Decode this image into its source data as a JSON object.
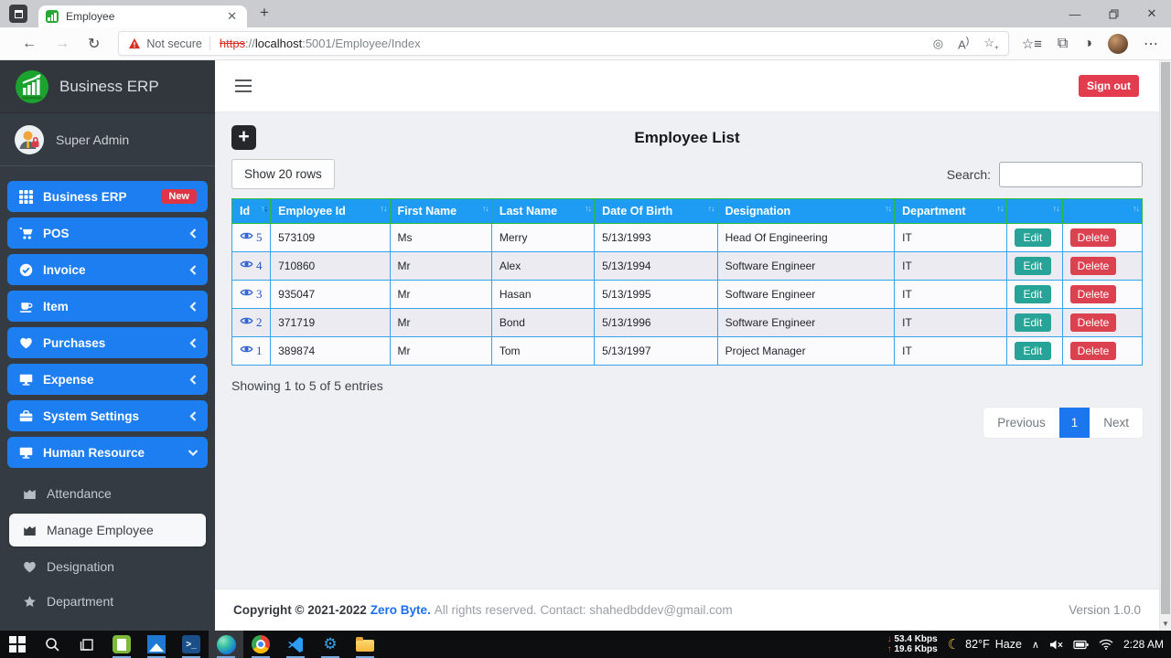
{
  "browser": {
    "tab_title": "Employee",
    "address": {
      "warning": "Not secure",
      "scheme": "https",
      "sep": "://",
      "host": "localhost",
      "path": ":5001/Employee/Index"
    }
  },
  "sidebar": {
    "brand": "Business ERP",
    "user": "Super Admin",
    "menu": [
      {
        "slug": "business-erp",
        "label": "Business ERP",
        "icon": "grid-icon",
        "badge": "New",
        "chevron": "none"
      },
      {
        "slug": "pos",
        "label": "POS",
        "icon": "cart-icon",
        "chevron": "left"
      },
      {
        "slug": "invoice",
        "label": "Invoice",
        "icon": "check-circle-icon",
        "chevron": "left"
      },
      {
        "slug": "item",
        "label": "Item",
        "icon": "mug-icon",
        "chevron": "left"
      },
      {
        "slug": "purchases",
        "label": "Purchases",
        "icon": "heart-icon",
        "chevron": "left"
      },
      {
        "slug": "expense",
        "label": "Expense",
        "icon": "desktop-icon",
        "chevron": "left"
      },
      {
        "slug": "system-settings",
        "label": "System Settings",
        "icon": "toolbox-icon",
        "chevron": "left"
      },
      {
        "slug": "human-resource",
        "label": "Human Resource",
        "icon": "desktop-icon",
        "chevron": "down"
      }
    ],
    "submenu": [
      {
        "slug": "attendance",
        "label": "Attendance",
        "icon": "chart-area-icon",
        "selected": false
      },
      {
        "slug": "manage-employee",
        "label": "Manage Employee",
        "icon": "chart-area-icon",
        "selected": true
      },
      {
        "slug": "designation",
        "label": "Designation",
        "icon": "heart-icon",
        "selected": false
      },
      {
        "slug": "department",
        "label": "Department",
        "icon": "star-icon",
        "selected": false
      }
    ]
  },
  "topbar": {
    "signout_label": "Sign out"
  },
  "main": {
    "title": "Employee List",
    "show_rows_label": "Show 20 rows",
    "search_label": "Search:",
    "table": {
      "headers": [
        "Id",
        "Employee Id",
        "First Name",
        "Last Name",
        "Date Of Birth",
        "Designation",
        "Department",
        "",
        ""
      ],
      "sorted_column": "Id",
      "sort_direction": "desc",
      "edit_label": "Edit",
      "delete_label": "Delete",
      "rows": [
        {
          "id": "5",
          "employee_id": "573109",
          "first_name": "Ms",
          "last_name": "Merry",
          "dob": "5/13/1993",
          "designation": "Head Of Engineering",
          "department": "IT"
        },
        {
          "id": "4",
          "employee_id": "710860",
          "first_name": "Mr",
          "last_name": "Alex",
          "dob": "5/13/1994",
          "designation": "Software Engineer",
          "department": "IT"
        },
        {
          "id": "3",
          "employee_id": "935047",
          "first_name": "Mr",
          "last_name": "Hasan",
          "dob": "5/13/1995",
          "designation": "Software Engineer",
          "department": "IT"
        },
        {
          "id": "2",
          "employee_id": "371719",
          "first_name": "Mr",
          "last_name": "Bond",
          "dob": "5/13/1996",
          "designation": "Software Engineer",
          "department": "IT"
        },
        {
          "id": "1",
          "employee_id": "389874",
          "first_name": "Mr",
          "last_name": "Tom",
          "dob": "5/13/1997",
          "designation": "Project Manager",
          "department": "IT"
        }
      ]
    },
    "info": "Showing 1 to 5 of 5 entries",
    "pagination": {
      "previous": "Previous",
      "page": "1",
      "next": "Next"
    }
  },
  "footer": {
    "copyright": "Copyright © 2021-2022",
    "brand": "Zero Byte.",
    "rights": "All rights reserved. Contact: shahedbddev@gmail.com",
    "version": "Version 1.0.0"
  },
  "taskbar": {
    "net_down": "53.4 Kbps",
    "net_up": "19.6 Kbps",
    "temperature": "82°F",
    "condition": "Haze",
    "time": "2:28 AM"
  },
  "colors": {
    "menu_blue": "#1d7ef2",
    "table_header_blue": "#1e9cf4",
    "table_border_green": "#2dbb3f",
    "table_border_blue": "#38a3ea",
    "danger_red": "#e23c4e",
    "edit_teal": "#27a398",
    "sidebar_dark": "#353b42"
  }
}
